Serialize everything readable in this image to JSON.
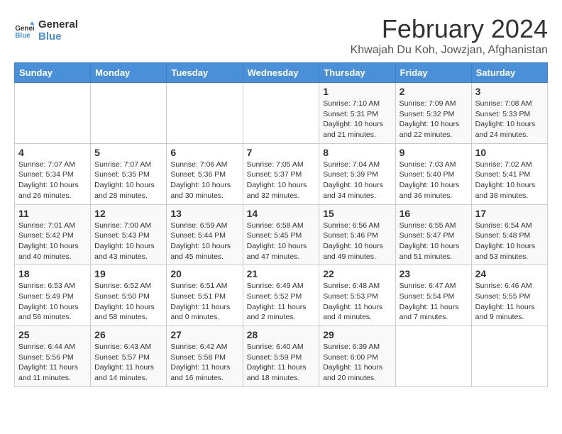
{
  "logo": {
    "line1": "General",
    "line2": "Blue"
  },
  "title": "February 2024",
  "location": "Khwajah Du Koh, Jowzjan, Afghanistan",
  "headers": [
    "Sunday",
    "Monday",
    "Tuesday",
    "Wednesday",
    "Thursday",
    "Friday",
    "Saturday"
  ],
  "weeks": [
    [
      {
        "day": "",
        "info": ""
      },
      {
        "day": "",
        "info": ""
      },
      {
        "day": "",
        "info": ""
      },
      {
        "day": "",
        "info": ""
      },
      {
        "day": "1",
        "info": "Sunrise: 7:10 AM\nSunset: 5:31 PM\nDaylight: 10 hours\nand 21 minutes."
      },
      {
        "day": "2",
        "info": "Sunrise: 7:09 AM\nSunset: 5:32 PM\nDaylight: 10 hours\nand 22 minutes."
      },
      {
        "day": "3",
        "info": "Sunrise: 7:08 AM\nSunset: 5:33 PM\nDaylight: 10 hours\nand 24 minutes."
      }
    ],
    [
      {
        "day": "4",
        "info": "Sunrise: 7:07 AM\nSunset: 5:34 PM\nDaylight: 10 hours\nand 26 minutes."
      },
      {
        "day": "5",
        "info": "Sunrise: 7:07 AM\nSunset: 5:35 PM\nDaylight: 10 hours\nand 28 minutes."
      },
      {
        "day": "6",
        "info": "Sunrise: 7:06 AM\nSunset: 5:36 PM\nDaylight: 10 hours\nand 30 minutes."
      },
      {
        "day": "7",
        "info": "Sunrise: 7:05 AM\nSunset: 5:37 PM\nDaylight: 10 hours\nand 32 minutes."
      },
      {
        "day": "8",
        "info": "Sunrise: 7:04 AM\nSunset: 5:39 PM\nDaylight: 10 hours\nand 34 minutes."
      },
      {
        "day": "9",
        "info": "Sunrise: 7:03 AM\nSunset: 5:40 PM\nDaylight: 10 hours\nand 36 minutes."
      },
      {
        "day": "10",
        "info": "Sunrise: 7:02 AM\nSunset: 5:41 PM\nDaylight: 10 hours\nand 38 minutes."
      }
    ],
    [
      {
        "day": "11",
        "info": "Sunrise: 7:01 AM\nSunset: 5:42 PM\nDaylight: 10 hours\nand 40 minutes."
      },
      {
        "day": "12",
        "info": "Sunrise: 7:00 AM\nSunset: 5:43 PM\nDaylight: 10 hours\nand 43 minutes."
      },
      {
        "day": "13",
        "info": "Sunrise: 6:59 AM\nSunset: 5:44 PM\nDaylight: 10 hours\nand 45 minutes."
      },
      {
        "day": "14",
        "info": "Sunrise: 6:58 AM\nSunset: 5:45 PM\nDaylight: 10 hours\nand 47 minutes."
      },
      {
        "day": "15",
        "info": "Sunrise: 6:56 AM\nSunset: 5:46 PM\nDaylight: 10 hours\nand 49 minutes."
      },
      {
        "day": "16",
        "info": "Sunrise: 6:55 AM\nSunset: 5:47 PM\nDaylight: 10 hours\nand 51 minutes."
      },
      {
        "day": "17",
        "info": "Sunrise: 6:54 AM\nSunset: 5:48 PM\nDaylight: 10 hours\nand 53 minutes."
      }
    ],
    [
      {
        "day": "18",
        "info": "Sunrise: 6:53 AM\nSunset: 5:49 PM\nDaylight: 10 hours\nand 56 minutes."
      },
      {
        "day": "19",
        "info": "Sunrise: 6:52 AM\nSunset: 5:50 PM\nDaylight: 10 hours\nand 58 minutes."
      },
      {
        "day": "20",
        "info": "Sunrise: 6:51 AM\nSunset: 5:51 PM\nDaylight: 11 hours\nand 0 minutes."
      },
      {
        "day": "21",
        "info": "Sunrise: 6:49 AM\nSunset: 5:52 PM\nDaylight: 11 hours\nand 2 minutes."
      },
      {
        "day": "22",
        "info": "Sunrise: 6:48 AM\nSunset: 5:53 PM\nDaylight: 11 hours\nand 4 minutes."
      },
      {
        "day": "23",
        "info": "Sunrise: 6:47 AM\nSunset: 5:54 PM\nDaylight: 11 hours\nand 7 minutes."
      },
      {
        "day": "24",
        "info": "Sunrise: 6:46 AM\nSunset: 5:55 PM\nDaylight: 11 hours\nand 9 minutes."
      }
    ],
    [
      {
        "day": "25",
        "info": "Sunrise: 6:44 AM\nSunset: 5:56 PM\nDaylight: 11 hours\nand 11 minutes."
      },
      {
        "day": "26",
        "info": "Sunrise: 6:43 AM\nSunset: 5:57 PM\nDaylight: 11 hours\nand 14 minutes."
      },
      {
        "day": "27",
        "info": "Sunrise: 6:42 AM\nSunset: 5:58 PM\nDaylight: 11 hours\nand 16 minutes."
      },
      {
        "day": "28",
        "info": "Sunrise: 6:40 AM\nSunset: 5:59 PM\nDaylight: 11 hours\nand 18 minutes."
      },
      {
        "day": "29",
        "info": "Sunrise: 6:39 AM\nSunset: 6:00 PM\nDaylight: 11 hours\nand 20 minutes."
      },
      {
        "day": "",
        "info": ""
      },
      {
        "day": "",
        "info": ""
      }
    ]
  ]
}
